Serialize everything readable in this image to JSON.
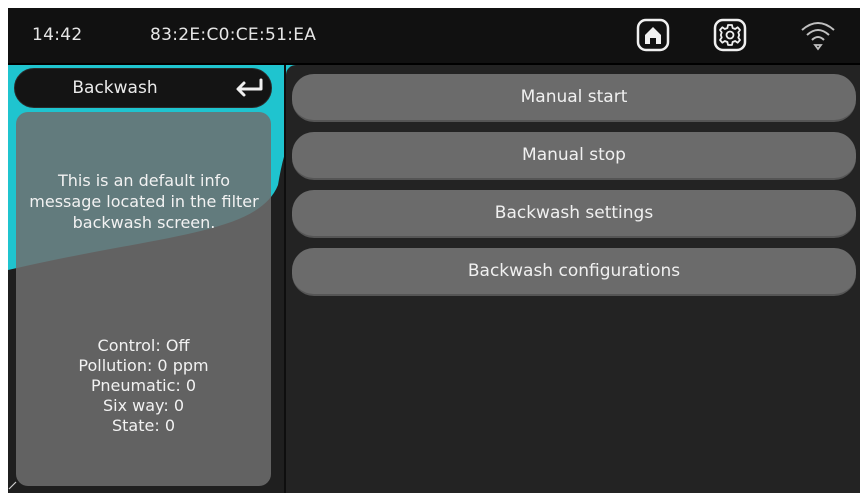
{
  "status_bar": {
    "time": "14:42",
    "mac_address": "83:2E:C0:CE:51:EA",
    "icons": [
      "home-icon",
      "gear-icon",
      "wifi-icon"
    ]
  },
  "left_panel": {
    "title": "Backwash",
    "back_icon": "return-arrow-icon",
    "info_message": "This is an default info message located in the filter backwash screen.",
    "status": {
      "control": "Control: Off",
      "pollution": "Pollution: 0 ppm",
      "pneumatic": "Pneumatic: 0",
      "six_way": "Six way: 0",
      "state": "State: 0"
    }
  },
  "actions": [
    {
      "label": "Manual start"
    },
    {
      "label": "Manual stop"
    },
    {
      "label": "Backwash settings"
    },
    {
      "label": "Backwash configurations"
    }
  ],
  "colors": {
    "accent_teal": "#1fc4cf",
    "background": "#1f1f1f",
    "button": "#6b6b6b"
  }
}
